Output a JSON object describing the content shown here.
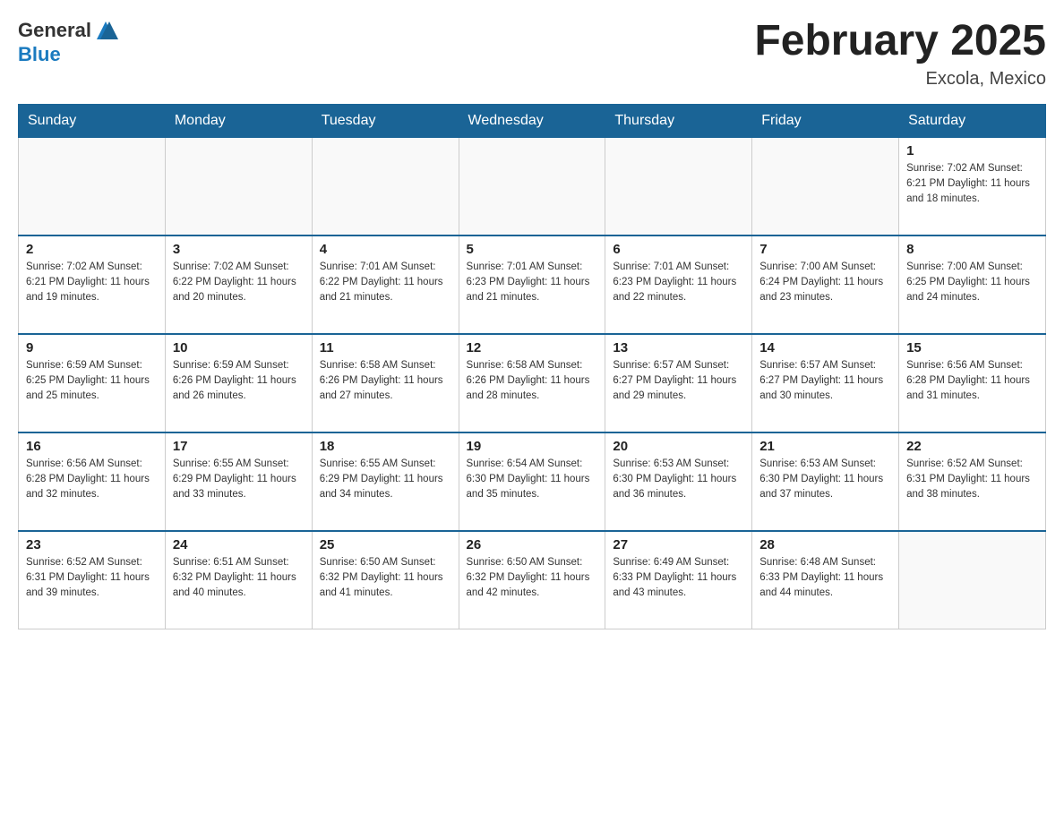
{
  "header": {
    "logo_general": "General",
    "logo_blue": "Blue",
    "month_title": "February 2025",
    "location": "Excola, Mexico"
  },
  "weekdays": [
    "Sunday",
    "Monday",
    "Tuesday",
    "Wednesday",
    "Thursday",
    "Friday",
    "Saturday"
  ],
  "weeks": [
    [
      {
        "day": "",
        "info": ""
      },
      {
        "day": "",
        "info": ""
      },
      {
        "day": "",
        "info": ""
      },
      {
        "day": "",
        "info": ""
      },
      {
        "day": "",
        "info": ""
      },
      {
        "day": "",
        "info": ""
      },
      {
        "day": "1",
        "info": "Sunrise: 7:02 AM\nSunset: 6:21 PM\nDaylight: 11 hours and 18 minutes."
      }
    ],
    [
      {
        "day": "2",
        "info": "Sunrise: 7:02 AM\nSunset: 6:21 PM\nDaylight: 11 hours and 19 minutes."
      },
      {
        "day": "3",
        "info": "Sunrise: 7:02 AM\nSunset: 6:22 PM\nDaylight: 11 hours and 20 minutes."
      },
      {
        "day": "4",
        "info": "Sunrise: 7:01 AM\nSunset: 6:22 PM\nDaylight: 11 hours and 21 minutes."
      },
      {
        "day": "5",
        "info": "Sunrise: 7:01 AM\nSunset: 6:23 PM\nDaylight: 11 hours and 21 minutes."
      },
      {
        "day": "6",
        "info": "Sunrise: 7:01 AM\nSunset: 6:23 PM\nDaylight: 11 hours and 22 minutes."
      },
      {
        "day": "7",
        "info": "Sunrise: 7:00 AM\nSunset: 6:24 PM\nDaylight: 11 hours and 23 minutes."
      },
      {
        "day": "8",
        "info": "Sunrise: 7:00 AM\nSunset: 6:25 PM\nDaylight: 11 hours and 24 minutes."
      }
    ],
    [
      {
        "day": "9",
        "info": "Sunrise: 6:59 AM\nSunset: 6:25 PM\nDaylight: 11 hours and 25 minutes."
      },
      {
        "day": "10",
        "info": "Sunrise: 6:59 AM\nSunset: 6:26 PM\nDaylight: 11 hours and 26 minutes."
      },
      {
        "day": "11",
        "info": "Sunrise: 6:58 AM\nSunset: 6:26 PM\nDaylight: 11 hours and 27 minutes."
      },
      {
        "day": "12",
        "info": "Sunrise: 6:58 AM\nSunset: 6:26 PM\nDaylight: 11 hours and 28 minutes."
      },
      {
        "day": "13",
        "info": "Sunrise: 6:57 AM\nSunset: 6:27 PM\nDaylight: 11 hours and 29 minutes."
      },
      {
        "day": "14",
        "info": "Sunrise: 6:57 AM\nSunset: 6:27 PM\nDaylight: 11 hours and 30 minutes."
      },
      {
        "day": "15",
        "info": "Sunrise: 6:56 AM\nSunset: 6:28 PM\nDaylight: 11 hours and 31 minutes."
      }
    ],
    [
      {
        "day": "16",
        "info": "Sunrise: 6:56 AM\nSunset: 6:28 PM\nDaylight: 11 hours and 32 minutes."
      },
      {
        "day": "17",
        "info": "Sunrise: 6:55 AM\nSunset: 6:29 PM\nDaylight: 11 hours and 33 minutes."
      },
      {
        "day": "18",
        "info": "Sunrise: 6:55 AM\nSunset: 6:29 PM\nDaylight: 11 hours and 34 minutes."
      },
      {
        "day": "19",
        "info": "Sunrise: 6:54 AM\nSunset: 6:30 PM\nDaylight: 11 hours and 35 minutes."
      },
      {
        "day": "20",
        "info": "Sunrise: 6:53 AM\nSunset: 6:30 PM\nDaylight: 11 hours and 36 minutes."
      },
      {
        "day": "21",
        "info": "Sunrise: 6:53 AM\nSunset: 6:30 PM\nDaylight: 11 hours and 37 minutes."
      },
      {
        "day": "22",
        "info": "Sunrise: 6:52 AM\nSunset: 6:31 PM\nDaylight: 11 hours and 38 minutes."
      }
    ],
    [
      {
        "day": "23",
        "info": "Sunrise: 6:52 AM\nSunset: 6:31 PM\nDaylight: 11 hours and 39 minutes."
      },
      {
        "day": "24",
        "info": "Sunrise: 6:51 AM\nSunset: 6:32 PM\nDaylight: 11 hours and 40 minutes."
      },
      {
        "day": "25",
        "info": "Sunrise: 6:50 AM\nSunset: 6:32 PM\nDaylight: 11 hours and 41 minutes."
      },
      {
        "day": "26",
        "info": "Sunrise: 6:50 AM\nSunset: 6:32 PM\nDaylight: 11 hours and 42 minutes."
      },
      {
        "day": "27",
        "info": "Sunrise: 6:49 AM\nSunset: 6:33 PM\nDaylight: 11 hours and 43 minutes."
      },
      {
        "day": "28",
        "info": "Sunrise: 6:48 AM\nSunset: 6:33 PM\nDaylight: 11 hours and 44 minutes."
      },
      {
        "day": "",
        "info": ""
      }
    ]
  ]
}
